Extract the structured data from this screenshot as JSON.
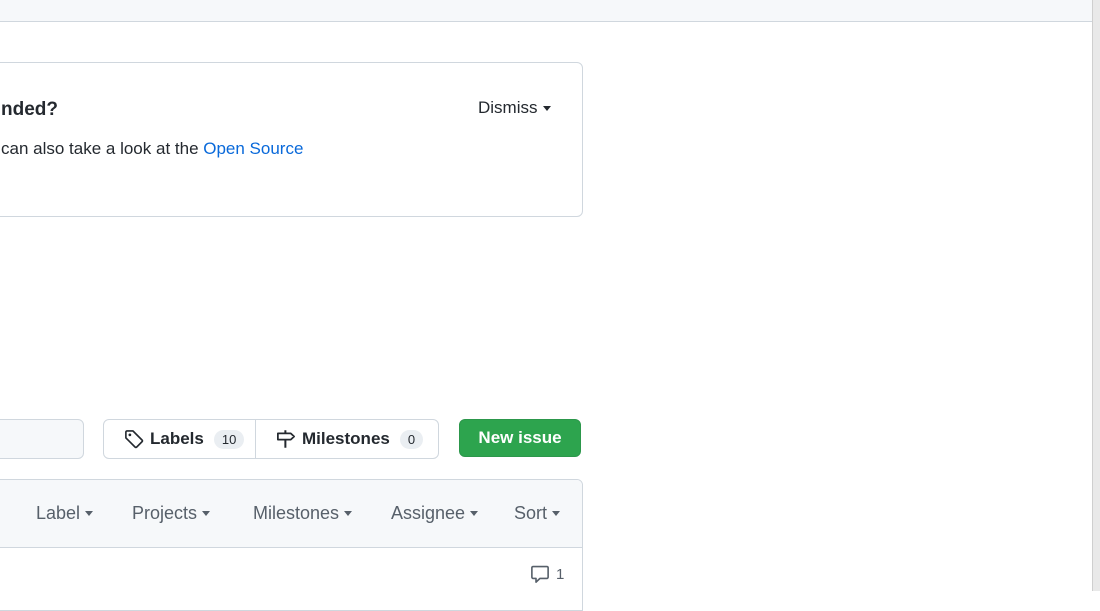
{
  "banner": {
    "title_fragment": "nded?",
    "text_fragment": "can also take a look at the ",
    "link_text": "Open Source",
    "dismiss_label": "Dismiss"
  },
  "toolbar": {
    "labels_label": "Labels",
    "labels_count": "10",
    "milestones_label": "Milestones",
    "milestones_count": "0",
    "new_issue_label": "New issue"
  },
  "list_header": {
    "filters": [
      "Label",
      "Projects",
      "Milestones",
      "Assignee",
      "Sort"
    ]
  },
  "issue": {
    "comment_count": "1"
  },
  "icons": [
    "tag-icon",
    "milestone-icon",
    "comment-icon",
    "caret-down-icon"
  ],
  "colors": {
    "primary_button": "#2da44e",
    "link": "#0969da",
    "border": "#d0d7de",
    "header_bg": "#f6f8fa"
  }
}
